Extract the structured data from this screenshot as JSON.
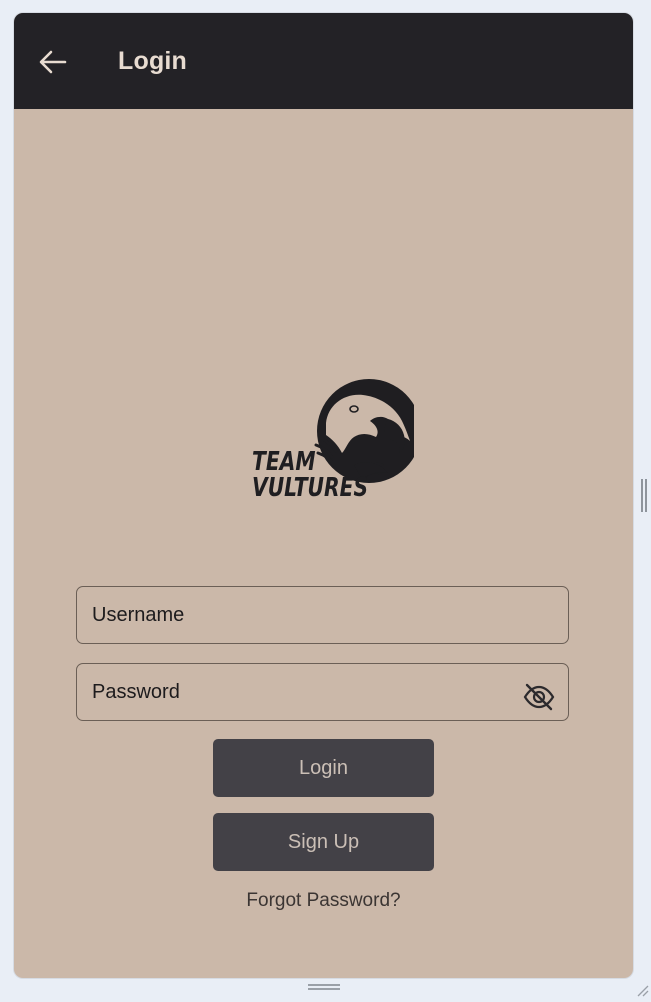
{
  "app_bar": {
    "title": "Login",
    "background": "#232226",
    "back_icon": "arrow-left-icon"
  },
  "logo": {
    "line1": "TEAM",
    "line2": "VULTURES",
    "icon": "vulture-logo-icon"
  },
  "form": {
    "username_placeholder": "Username",
    "password_placeholder": "Password",
    "password_toggle_icon": "eye-off-icon"
  },
  "buttons": {
    "login_label": "Login",
    "signup_label": "Sign Up"
  },
  "links": {
    "forgot_password": "Forgot Password?"
  },
  "colors": {
    "page_background": "#cbb8a9",
    "button_background": "#434147",
    "button_text": "#cbbfb6",
    "field_border": "#6b5f56"
  }
}
